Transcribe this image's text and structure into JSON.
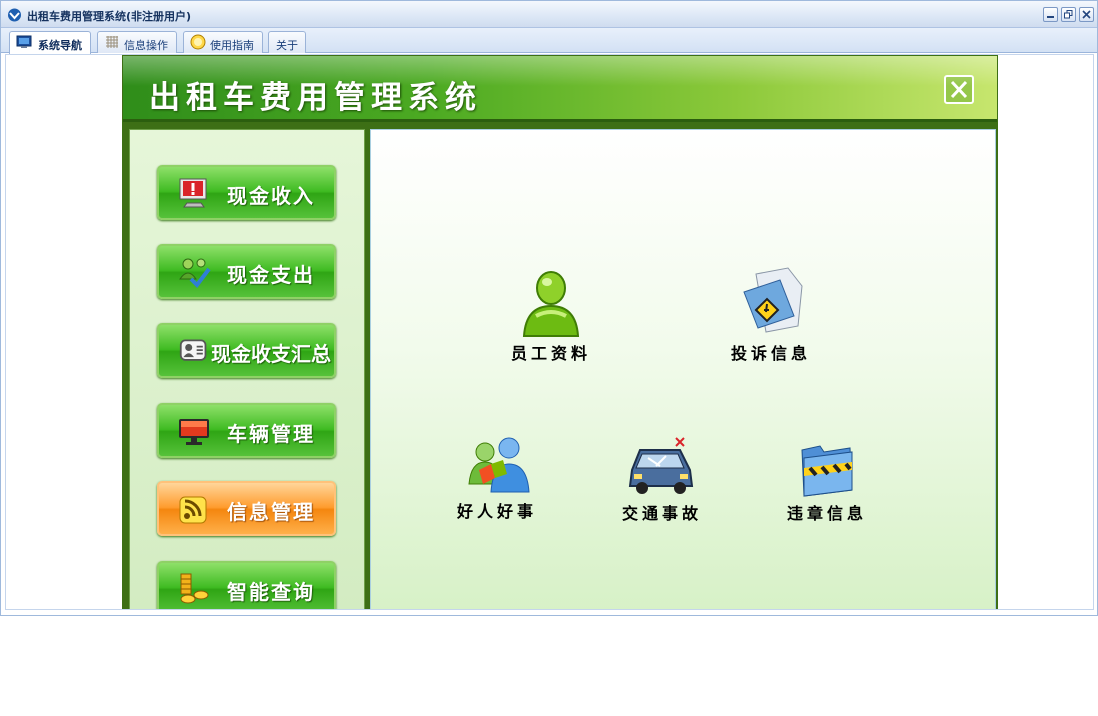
{
  "window": {
    "title": "出租车费用管理系统(非注册用户)",
    "buttons": [
      "minimize-icon",
      "restore-icon",
      "close-icon"
    ]
  },
  "tabs": [
    {
      "label": "系统导航",
      "icon": "monitor-icon",
      "active": true
    },
    {
      "label": "信息操作",
      "icon": "grid-icon",
      "active": false
    },
    {
      "label": "使用指南",
      "icon": "help-globe-icon",
      "active": false
    },
    {
      "label": "关于",
      "icon": "",
      "active": false
    }
  ],
  "app": {
    "banner_title": "出租车费用管理系统",
    "close_icon": "close-icon",
    "colors": {
      "accent_green": "#3fbb22",
      "active_orange": "#ff9c2e",
      "banner_dark": "#2f8d1a"
    }
  },
  "menu": [
    {
      "label": "现金收入",
      "icon": "alert-monitor-icon",
      "active": false
    },
    {
      "label": "现金支出",
      "icon": "users-check-icon",
      "active": false
    },
    {
      "label": "现金收支汇总",
      "icon": "user-card-icon",
      "active": false
    },
    {
      "label": "车辆管理",
      "icon": "monitor-red-icon",
      "active": false
    },
    {
      "label": "信息管理",
      "icon": "rss-icon",
      "active": true
    },
    {
      "label": "智能查询",
      "icon": "coins-icon",
      "active": false
    }
  ],
  "features": [
    {
      "label": "员工资料",
      "icon": "user-icon"
    },
    {
      "label": "投诉信息",
      "icon": "warning-folder-icon"
    },
    {
      "label": "好人好事",
      "icon": "people-icon"
    },
    {
      "label": "交通事故",
      "icon": "crashed-car-icon"
    },
    {
      "label": "违章信息",
      "icon": "barrier-folder-icon"
    }
  ]
}
